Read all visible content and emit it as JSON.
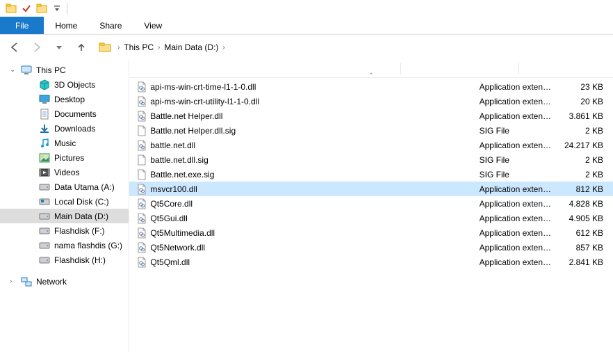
{
  "qat": {
    "items": [
      "folder",
      "check",
      "folder-open",
      "dropdown"
    ]
  },
  "ribbon": {
    "file": "File",
    "tabs": [
      "Home",
      "Share",
      "View"
    ]
  },
  "nav": {
    "breadcrumb": [
      "This PC",
      "Main Data (D:)"
    ]
  },
  "sidebar": {
    "root": "This PC",
    "items": [
      {
        "icon": "cube3d",
        "label": "3D Objects"
      },
      {
        "icon": "desktop",
        "label": "Desktop"
      },
      {
        "icon": "documents",
        "label": "Documents"
      },
      {
        "icon": "downloads",
        "label": "Downloads"
      },
      {
        "icon": "music",
        "label": "Music"
      },
      {
        "icon": "pictures",
        "label": "Pictures"
      },
      {
        "icon": "videos",
        "label": "Videos"
      },
      {
        "icon": "drive",
        "label": "Data Utama (A:)"
      },
      {
        "icon": "drive-win",
        "label": "Local Disk (C:)"
      },
      {
        "icon": "drive",
        "label": "Main Data (D:)",
        "selected": true
      },
      {
        "icon": "drive",
        "label": "Flashdisk (F:)"
      },
      {
        "icon": "drive",
        "label": "nama flashdis (G:)"
      },
      {
        "icon": "drive",
        "label": "Flashdisk (H:)"
      }
    ],
    "network": "Network"
  },
  "columns": {
    "seps": [
      390,
      560,
      700,
      790
    ]
  },
  "files": [
    {
      "name": "api-ms-win-crt-time-l1-1-0.dll",
      "type": "Application exten…",
      "size": "23 KB"
    },
    {
      "name": "api-ms-win-crt-utility-l1-1-0.dll",
      "type": "Application exten…",
      "size": "20 KB"
    },
    {
      "name": "Battle.net Helper.dll",
      "type": "Application exten…",
      "size": "3.861 KB"
    },
    {
      "name": "Battle.net Helper.dll.sig",
      "type": "SIG File",
      "size": "2 KB",
      "icon": "blank"
    },
    {
      "name": "battle.net.dll",
      "type": "Application exten…",
      "size": "24.217 KB"
    },
    {
      "name": "battle.net.dll.sig",
      "type": "SIG File",
      "size": "2 KB",
      "icon": "blank"
    },
    {
      "name": "Battle.net.exe.sig",
      "type": "SIG File",
      "size": "2 KB",
      "icon": "blank"
    },
    {
      "name": "msvcr100.dll",
      "type": "Application exten…",
      "size": "812 KB",
      "selected": true
    },
    {
      "name": "Qt5Core.dll",
      "type": "Application exten…",
      "size": "4.828 KB"
    },
    {
      "name": "Qt5Gui.dll",
      "type": "Application exten…",
      "size": "4.905 KB"
    },
    {
      "name": "Qt5Multimedia.dll",
      "type": "Application exten…",
      "size": "612 KB"
    },
    {
      "name": "Qt5Network.dll",
      "type": "Application exten…",
      "size": "857 KB"
    },
    {
      "name": "Qt5Qml.dll",
      "type": "Application exten…",
      "size": "2.841 KB"
    }
  ]
}
